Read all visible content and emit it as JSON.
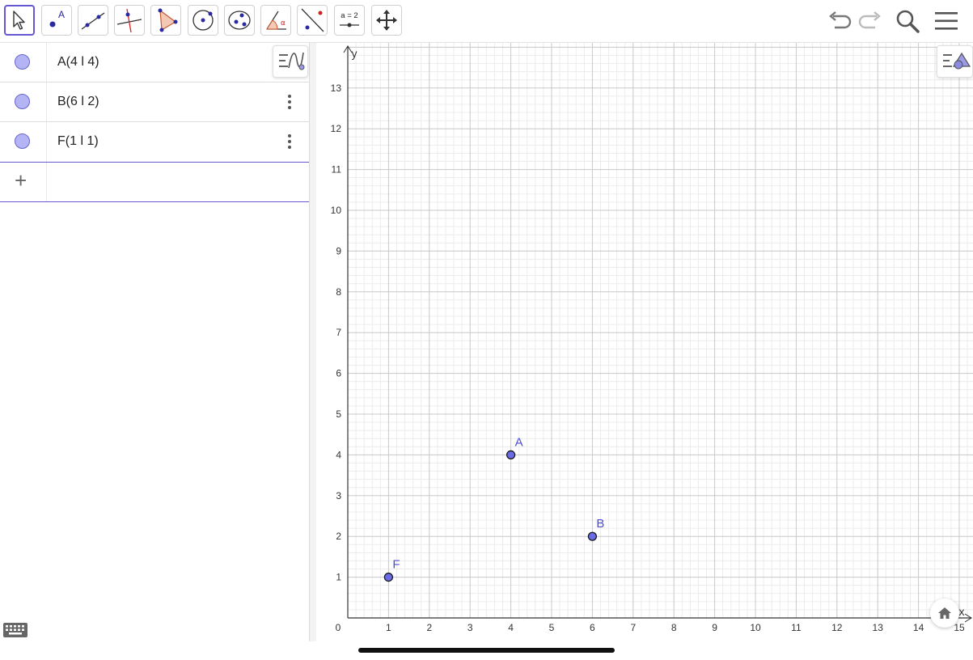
{
  "toolbar": {
    "tools": [
      {
        "name": "move-tool",
        "selected": true
      },
      {
        "name": "point-tool",
        "label": "A"
      },
      {
        "name": "line-tool"
      },
      {
        "name": "perpendicular-line-tool"
      },
      {
        "name": "polygon-tool"
      },
      {
        "name": "circle-tool"
      },
      {
        "name": "ellipse-tool"
      },
      {
        "name": "angle-tool",
        "label": "α"
      },
      {
        "name": "reflect-tool"
      },
      {
        "name": "slider-tool",
        "label": "a = 2"
      },
      {
        "name": "move-graphics-tool"
      }
    ],
    "right_icons": [
      "undo-icon",
      "redo-icon",
      "search-icon",
      "menu-icon"
    ]
  },
  "algebra": {
    "items": [
      {
        "text": "A(4 l 4)"
      },
      {
        "text": "B(6 l 2)"
      },
      {
        "text": "F(1 l 1)"
      }
    ],
    "input_placeholder": "",
    "point_color": "#b4b4f5"
  },
  "graphics": {
    "xlabel": "x",
    "ylabel": "y",
    "origin_label": "0",
    "x_ticks": [
      "1",
      "2",
      "3",
      "4",
      "5",
      "6",
      "7",
      "8",
      "9",
      "10",
      "11",
      "12",
      "13",
      "14",
      "15"
    ],
    "y_ticks": [
      "1",
      "2",
      "3",
      "4",
      "5",
      "6",
      "7",
      "8",
      "9",
      "10",
      "11",
      "12",
      "13"
    ],
    "accent_color": "#6557d2",
    "point_fill": "#6b6be6",
    "label_color": "#4d4dd6"
  },
  "chart_data": {
    "type": "scatter",
    "title": "",
    "xlabel": "x",
    "ylabel": "y",
    "xlim": [
      0,
      15
    ],
    "ylim": [
      0,
      13.9
    ],
    "grid": true,
    "series": [
      {
        "points": [
          {
            "label": "A",
            "x": 4,
            "y": 4
          },
          {
            "label": "B",
            "x": 6,
            "y": 2
          },
          {
            "label": "F",
            "x": 1,
            "y": 1
          }
        ]
      }
    ]
  }
}
